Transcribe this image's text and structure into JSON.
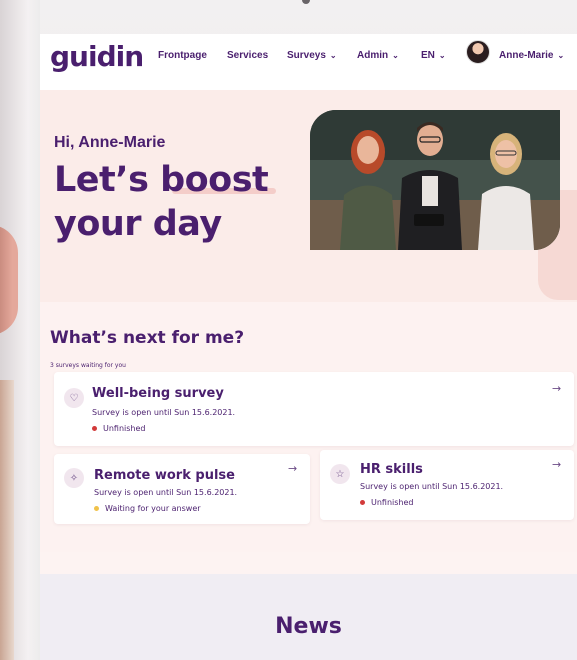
{
  "nav": {
    "logo": "guidin",
    "frontpage": "Frontpage",
    "services": "Services",
    "surveys": "Surveys",
    "admin": "Admin",
    "language": "EN",
    "user": "Anne-Marie"
  },
  "hero": {
    "greeting": "Hi, Anne-Marie",
    "headline_line1": "Let’s boost",
    "headline_line2": "your day"
  },
  "next": {
    "title": "What’s next for me?",
    "subtitle": "3 surveys waiting for you",
    "cards": [
      {
        "icon": "heart-icon",
        "title": "Well-being survey",
        "date": "Survey is open until Sun 15.6.2021.",
        "status": "Unfinished",
        "status_color": "#d23a3a"
      },
      {
        "icon": "sparkle-icon",
        "title": "Remote work pulse",
        "date": "Survey is open until Sun 15.6.2021.",
        "status": "Waiting for your answer",
        "status_color": "#f0c24a"
      },
      {
        "icon": "star-icon",
        "title": "HR skills",
        "date": "Survey is open until Sun 15.6.2021.",
        "status": "Unfinished",
        "status_color": "#d23a3a"
      }
    ]
  },
  "news": {
    "title": "News"
  },
  "colors": {
    "brand": "#4a1f6e",
    "hero_bg": "#fbece9",
    "news_bg": "#f0edf3"
  }
}
